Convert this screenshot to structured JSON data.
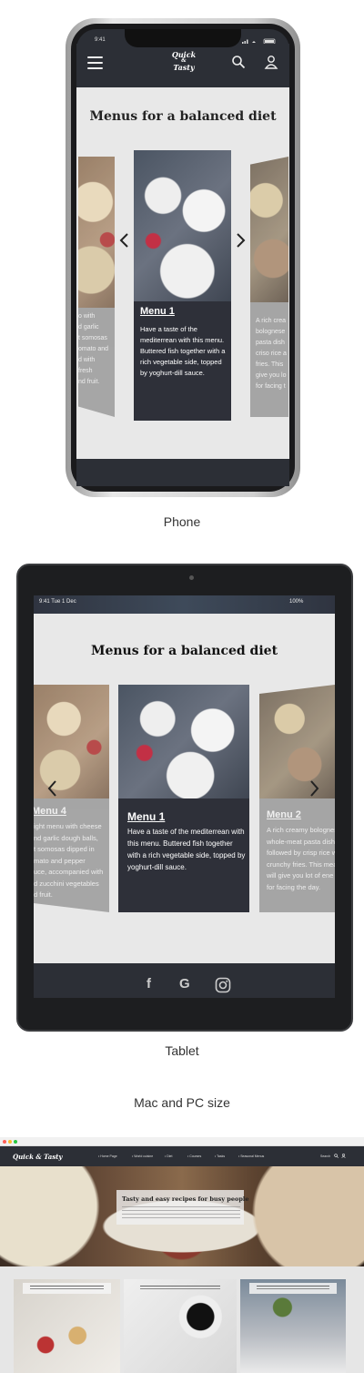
{
  "phone": {
    "status_time": "9:41",
    "logo_line1": "Quick",
    "logo_line2": "&",
    "logo_line3": "Tasty",
    "title": "Menus for a balanced diet",
    "center_card": {
      "heading": "Menu 1",
      "text": "Have a taste of the mediterrean with this menu. Buttered fish together with a rich vegetable side, topped by yoghurt-dill sauce."
    },
    "left_card_lines": [
      "o with",
      "d garlic",
      "t somosas",
      "omato and",
      "d with",
      "fresh",
      "nd fruit."
    ],
    "right_card_lines": [
      "A rich crea",
      "bolognese",
      "pasta dish",
      "criso rice a",
      "fries. This",
      "give you lo",
      "for facing t"
    ],
    "caption": "Phone"
  },
  "tablet": {
    "status_left": "9:41   Tue 1 Dec",
    "status_right": "100%",
    "title": "Menus for a balanced diet",
    "center_card": {
      "heading": "Menu 1",
      "text": "Have a taste of the mediterrean with this menu. Buttered fish together with a rich vegetable side, topped by yoghurt-dill sauce."
    },
    "left_card": {
      "heading": "Menu 4",
      "lines": [
        "ight menu with cheese",
        "nd garlic dough balls,",
        "t somosas dipped in",
        "mato and pepper",
        "uce, accompanied with",
        "d zucchini vegetables",
        "d fruit."
      ]
    },
    "right_card": {
      "heading": "Menu 2",
      "lines": [
        "A rich creamy bolognes",
        "whole-meat pasta dish",
        "followed by crisp rice w",
        "crunchy fries. This mea",
        "will give you lot of ene",
        "for facing the day."
      ]
    },
    "caption": "Tablet"
  },
  "desktop": {
    "section_caption": "Mac and PC size",
    "logo": "Quick & Tasty",
    "nav_items": [
      "• Home Page",
      "• World cuisine",
      "• Diet",
      "• Courses",
      "• Tasks",
      "• Seasonal Menus"
    ],
    "search_label": "Search",
    "hero_title": "Tasty and easy recipes for busy people"
  }
}
